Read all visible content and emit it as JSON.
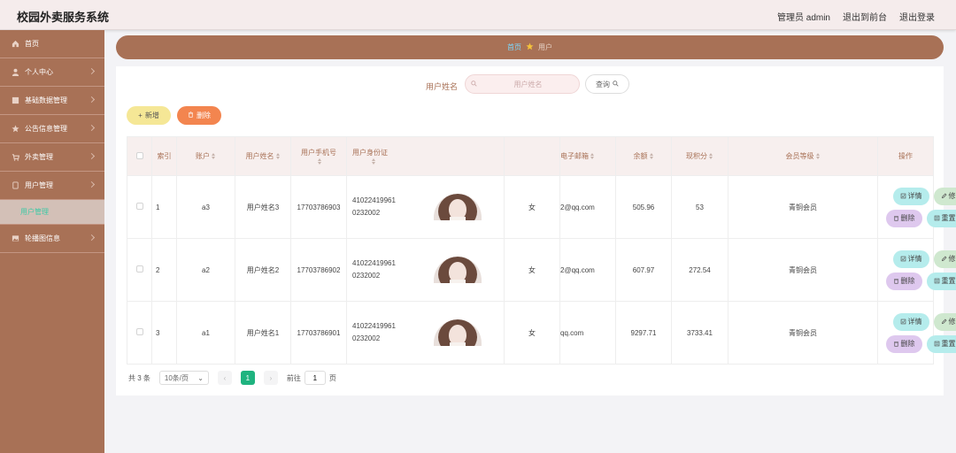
{
  "app": {
    "title": "校园外卖服务系统"
  },
  "topbar": {
    "user_label": "管理员 admin",
    "front_label": "退出到前台",
    "logout_label": "退出登录"
  },
  "sidebar": {
    "items": [
      {
        "label": "首页",
        "icon": "home-icon"
      },
      {
        "label": "个人中心",
        "icon": "user-icon"
      },
      {
        "label": "基础数据管理",
        "icon": "grid-icon"
      },
      {
        "label": "公告信息管理",
        "icon": "star-icon"
      },
      {
        "label": "外卖管理",
        "icon": "cart-icon"
      },
      {
        "label": "用户管理",
        "icon": "doc-icon"
      },
      {
        "label": "轮播图信息",
        "icon": "image-icon"
      }
    ],
    "active_sub": "用户管理"
  },
  "breadcrumb": {
    "home": "首页",
    "current": "用户"
  },
  "search": {
    "label": "用户姓名",
    "placeholder": "用户姓名",
    "value": "",
    "button_label": "查询"
  },
  "actions": {
    "add_label": "新增",
    "delete_label": "删除"
  },
  "table": {
    "headers": {
      "index": "索引",
      "account": "账户",
      "name": "用户姓名",
      "phone": "用户手机号",
      "idcard": "用户身份证",
      "email": "电子邮箱",
      "balance": "余额",
      "points": "现积分",
      "level": "会员等级",
      "ops": "操作"
    },
    "rows": [
      {
        "index": "1",
        "account": "a3",
        "name": "用户姓名3",
        "phone": "17703786903",
        "idcard": "41022419961 0232002",
        "gender": "女",
        "email": "2@qq.com",
        "balance": "505.96",
        "points": "53",
        "level": "青铜会员"
      },
      {
        "index": "2",
        "account": "a2",
        "name": "用户姓名2",
        "phone": "17703786902",
        "idcard": "41022419961 0232002",
        "gender": "女",
        "email": "2@qq.com",
        "balance": "607.97",
        "points": "272.54",
        "level": "青铜会员"
      },
      {
        "index": "3",
        "account": "a1",
        "name": "用户姓名1",
        "phone": "17703786901",
        "idcard": "41022419961 0232002",
        "gender": "女",
        "email": "qq.com",
        "balance": "9297.71",
        "points": "3733.41",
        "level": "青铜会员"
      }
    ],
    "op_labels": {
      "detail": "详情",
      "edit": "修改",
      "remove": "删除",
      "reset": "重置密码"
    }
  },
  "pager": {
    "total": "共 3 条",
    "size": "10条/页",
    "current": "1",
    "goto_prefix": "前往",
    "goto_value": "1",
    "goto_suffix": "页"
  },
  "colors": {
    "brand": "#a87156",
    "accent": "#1fb37f",
    "add_button": "#f5e796",
    "delete_button": "#f3854f"
  }
}
